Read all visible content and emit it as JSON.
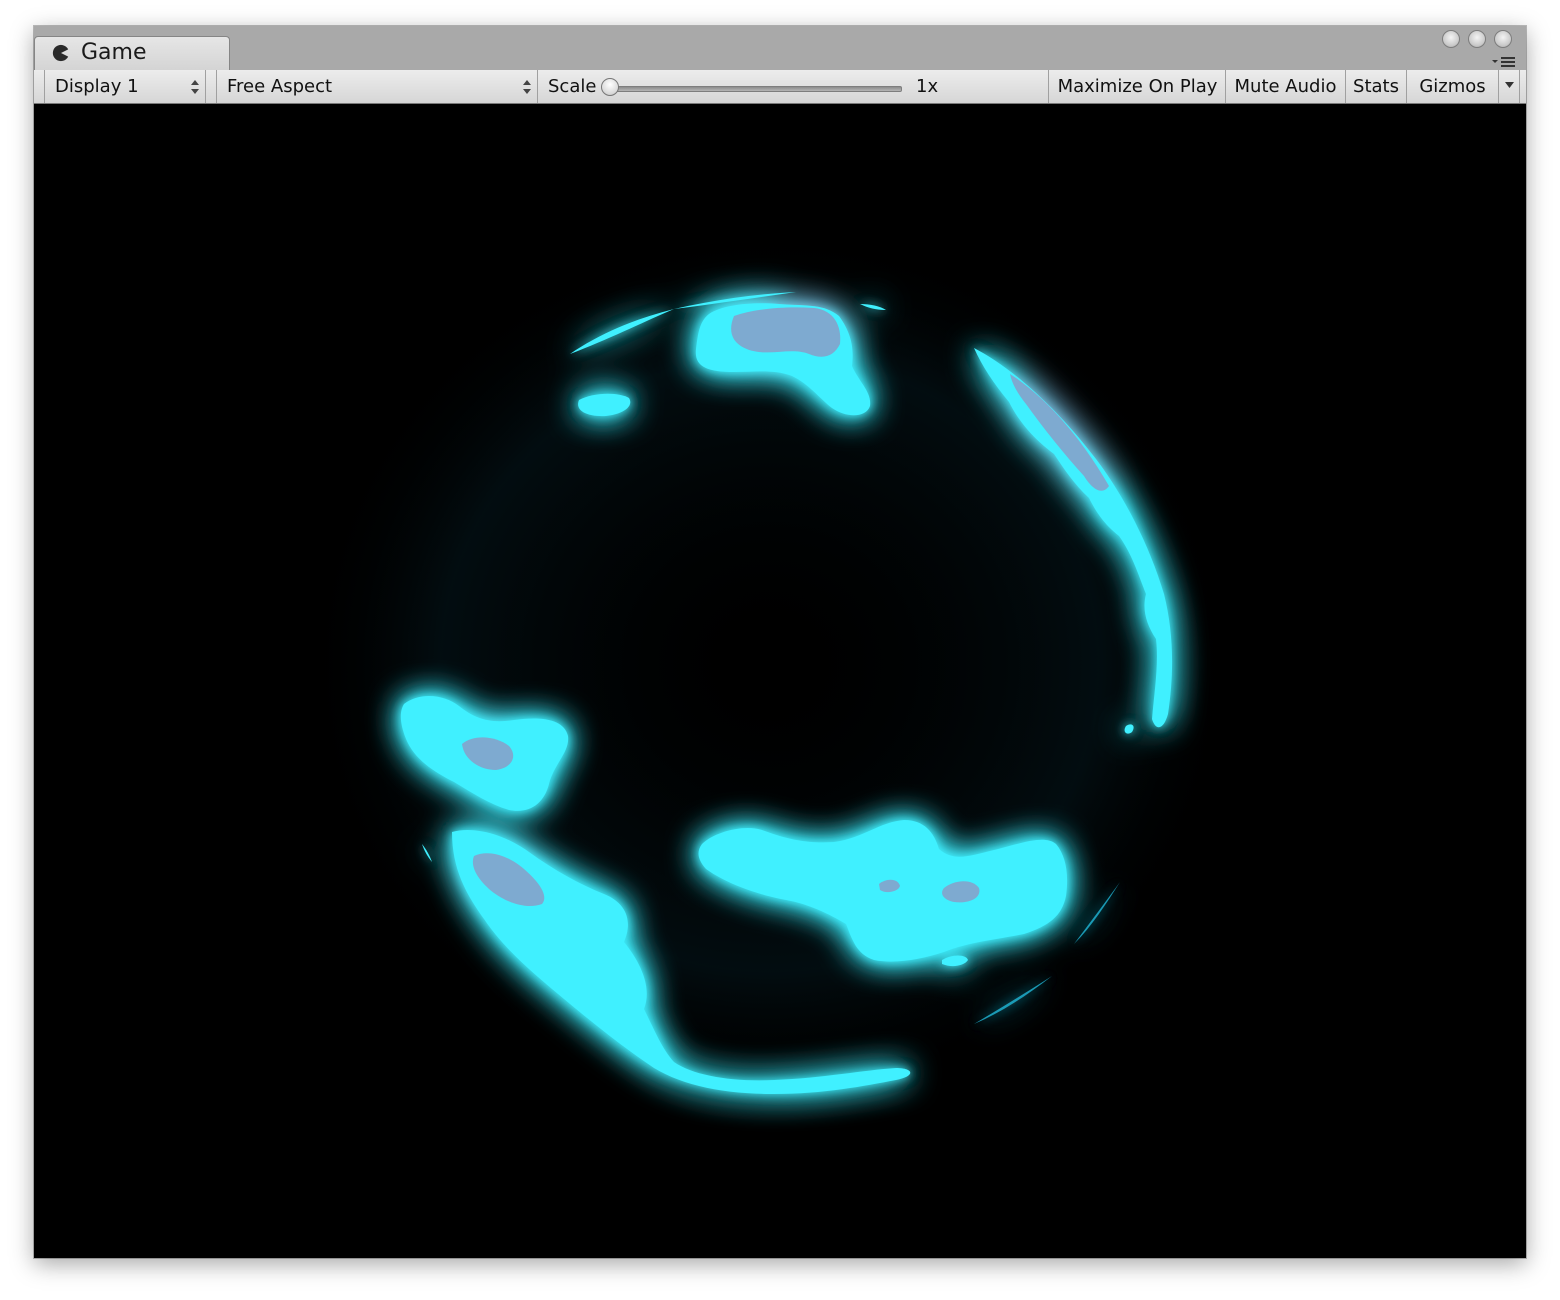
{
  "window": {
    "tab_title": "Game",
    "tab_icon": "pacman-icon"
  },
  "toolbar": {
    "display_select": "Display 1",
    "aspect_select": "Free Aspect",
    "scale_label": "Scale",
    "scale_value": "1x",
    "scale_slider_fraction": 0.0,
    "maximize_on_play": "Maximize On Play",
    "mute_audio": "Mute Audio",
    "stats": "Stats",
    "gizmos": "Gizmos",
    "gizmos_dropdown_icon": "chevron-down-icon"
  },
  "viewport": {
    "background_color": "#000000",
    "effect_color": "#3ff0ff",
    "effect_glow_color": "#1fb8d8",
    "effect_core_color": "#8a9ec8"
  }
}
